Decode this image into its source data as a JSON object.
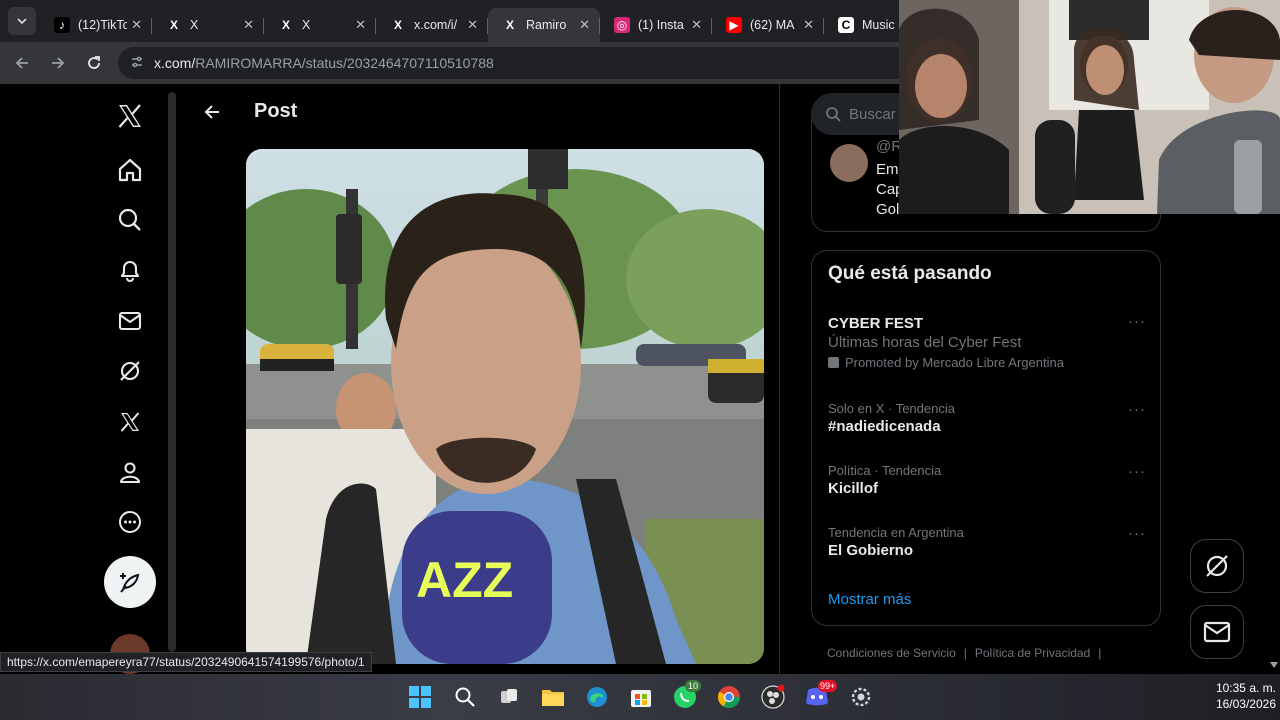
{
  "browser": {
    "tabs": [
      {
        "favicon": "tiktok-icon",
        "title": "(12)TikTo"
      },
      {
        "favicon": "x-logo-icon",
        "title": "X"
      },
      {
        "favicon": "x-logo-icon",
        "title": "X"
      },
      {
        "favicon": "x-logo-icon",
        "title": "x.com/i/"
      },
      {
        "favicon": "x-logo-icon",
        "title": "Ramiro"
      },
      {
        "favicon": "instagram-icon",
        "title": "(1) Insta"
      },
      {
        "favicon": "youtube-icon",
        "title": "(62) MA"
      },
      {
        "favicon": "music-icon",
        "title": "Music"
      }
    ],
    "active_tab": 4,
    "address": {
      "host": "x.com/",
      "path": "RAMIROMARRA/status/2032464707110510788"
    },
    "status_url": "https://x.com/emapereyra77/status/2032490641574199576/photo/1"
  },
  "post_header": {
    "title": "Post"
  },
  "search": {
    "placeholder": "Buscar"
  },
  "who_card": {
    "handle": "@R",
    "bio_lines": [
      "Emp",
      "Cap",
      "Golo..."
    ]
  },
  "trends": {
    "title": "Qué está pasando",
    "items": [
      {
        "meta": "",
        "name": "CYBER FEST",
        "desc": "Últimas horas del Cyber Fest",
        "promo": "Promoted by Mercado Libre Argentina"
      },
      {
        "meta": "Solo en X · Tendencia",
        "name": "#nadiedicenada",
        "desc": "",
        "promo": ""
      },
      {
        "meta": "Política · Tendencia",
        "name": "Kicillof",
        "desc": "",
        "promo": ""
      },
      {
        "meta": "Tendencia en Argentina",
        "name": "El Gobierno",
        "desc": "",
        "promo": ""
      }
    ],
    "more_label": "···",
    "show_more": "Mostrar más"
  },
  "footer": {
    "terms": "Condiciones de Servicio",
    "privacy": "Política de Privacidad",
    "sep": "|"
  },
  "media": {
    "mic_logo": "AZZ"
  },
  "taskbar": {
    "badges": {
      "whatsapp": "10",
      "discord": "99+"
    },
    "time": "10:35 a. m.",
    "date": "16/03/2026"
  },
  "colors": {
    "accent": "#1d9bf0",
    "background": "#000000",
    "text": "#e7e9ea",
    "muted": "#71767b"
  }
}
